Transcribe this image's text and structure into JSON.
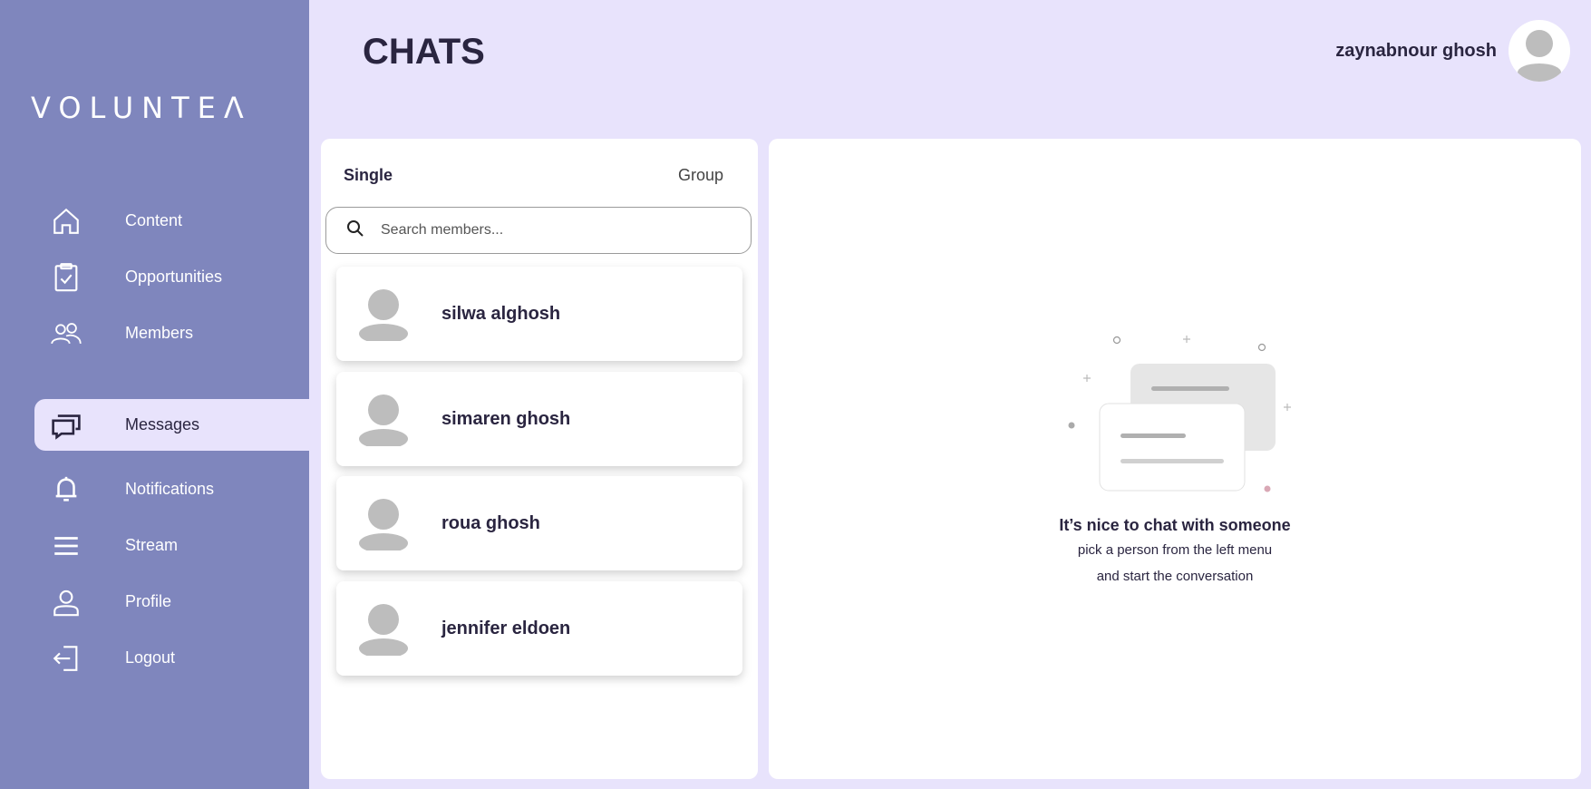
{
  "brand": {
    "logo_text": "VOLUNTEΛ"
  },
  "sidebar": {
    "items": [
      {
        "label": "Content",
        "icon": "home-icon"
      },
      {
        "label": "Opportunities",
        "icon": "clipboard-check-icon"
      },
      {
        "label": "Members",
        "icon": "users-icon"
      },
      {
        "label": "Messages",
        "icon": "chat-bubbles-icon",
        "active": true
      },
      {
        "label": "Notifications",
        "icon": "bell-icon"
      },
      {
        "label": "Stream",
        "icon": "menu-lines-icon"
      },
      {
        "label": "Profile",
        "icon": "user-icon"
      },
      {
        "label": "Logout",
        "icon": "logout-icon"
      }
    ]
  },
  "header": {
    "title": "CHATS",
    "user_name": "zaynabnour ghosh"
  },
  "list": {
    "tabs": {
      "single": "Single",
      "group": "Group"
    },
    "search_placeholder": "Search members...",
    "members": [
      {
        "name": "silwa alghosh"
      },
      {
        "name": "simaren ghosh"
      },
      {
        "name": "roua ghosh"
      },
      {
        "name": "jennifer eldoen"
      }
    ]
  },
  "empty_state": {
    "title": "It’s nice to chat with someone",
    "line1": "pick a person from the left menu",
    "line2": "and start the conversation"
  },
  "colors": {
    "sidebar": "#7f86bd",
    "background": "#e8e3fc",
    "text": "#2a2540"
  }
}
